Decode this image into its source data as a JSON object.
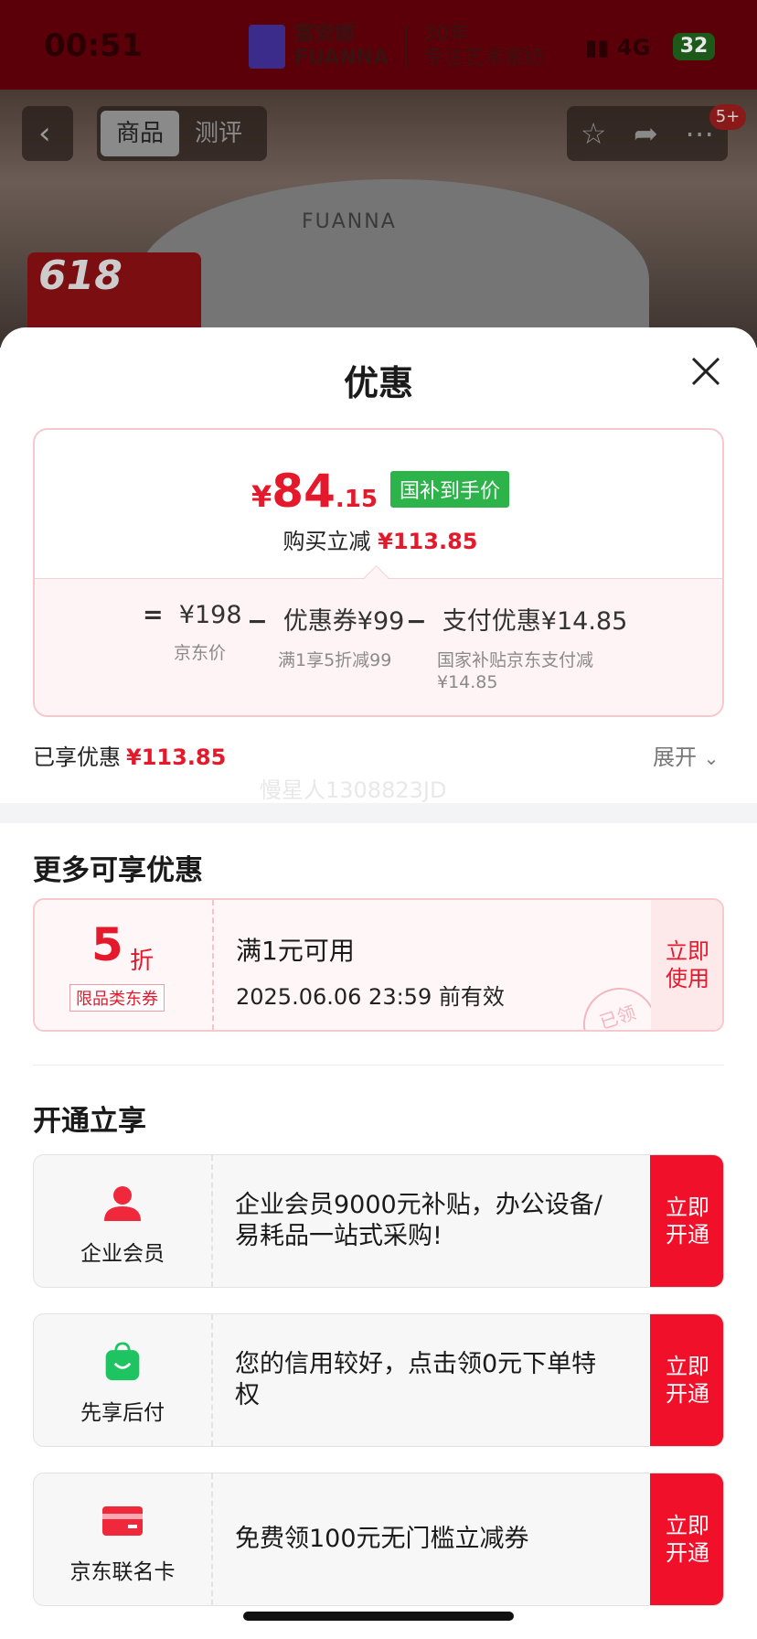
{
  "status_bar": {
    "time": "00:51",
    "network": "4G",
    "battery": "32"
  },
  "banner": {
    "brand_cn": "富安娜",
    "brand_en": "FUANNA",
    "slogan_top": "30年",
    "slogan": "专注艺术家纺"
  },
  "product_nav": {
    "tabs": [
      "商品",
      "测评"
    ],
    "message_badge": "5+",
    "product_mark": "FUANNA",
    "promo": "618"
  },
  "sheet": {
    "title": "优惠",
    "price": {
      "currency": "¥",
      "integer": "84",
      "decimal": ".15",
      "tag": "国补到手价",
      "reduce_label": "购买立减",
      "reduce_amount": "¥113.85"
    },
    "breakdown": [
      {
        "prefix": "=",
        "amount": "¥198",
        "desc": "京东价"
      },
      {
        "prefix": "−",
        "amount": "优惠券¥99",
        "desc": "满1享5折减99"
      },
      {
        "prefix": "−",
        "amount": "支付优惠¥14.85",
        "desc": "国家补贴京东支付减¥14.85"
      }
    ],
    "enjoyed_label": "已享优惠",
    "enjoyed_amount": "¥113.85",
    "expand_label": "展开",
    "watermark": "慢星人1308823JD"
  },
  "more_section": {
    "title": "更多可享优惠",
    "coupon": {
      "discount": "5",
      "unit": "折",
      "tag": "限品类东券",
      "condition": "满1元可用",
      "expiry": "2025.06.06 23:59 前有效",
      "action": "立即使用",
      "stamp": "已领"
    }
  },
  "open_section": {
    "title": "开通立享",
    "items": [
      {
        "label": "企业会员",
        "desc": "企业会员9000元补贴，办公设备/易耗品一站式采购!",
        "action": "立即开通",
        "icon": "person-icon"
      },
      {
        "label": "先享后付",
        "desc": "您的信用较好，点击领0元下单特权",
        "action": "立即开通",
        "icon": "shopping-bag-icon"
      },
      {
        "label": "京东联名卡",
        "desc": "免费领100元无门槛立减券",
        "action": "立即开通",
        "icon": "credit-card-icon"
      }
    ]
  },
  "colors": {
    "accent_red": "#e4192b",
    "green_tag": "#2cb34a",
    "button_red": "#f0102a"
  }
}
